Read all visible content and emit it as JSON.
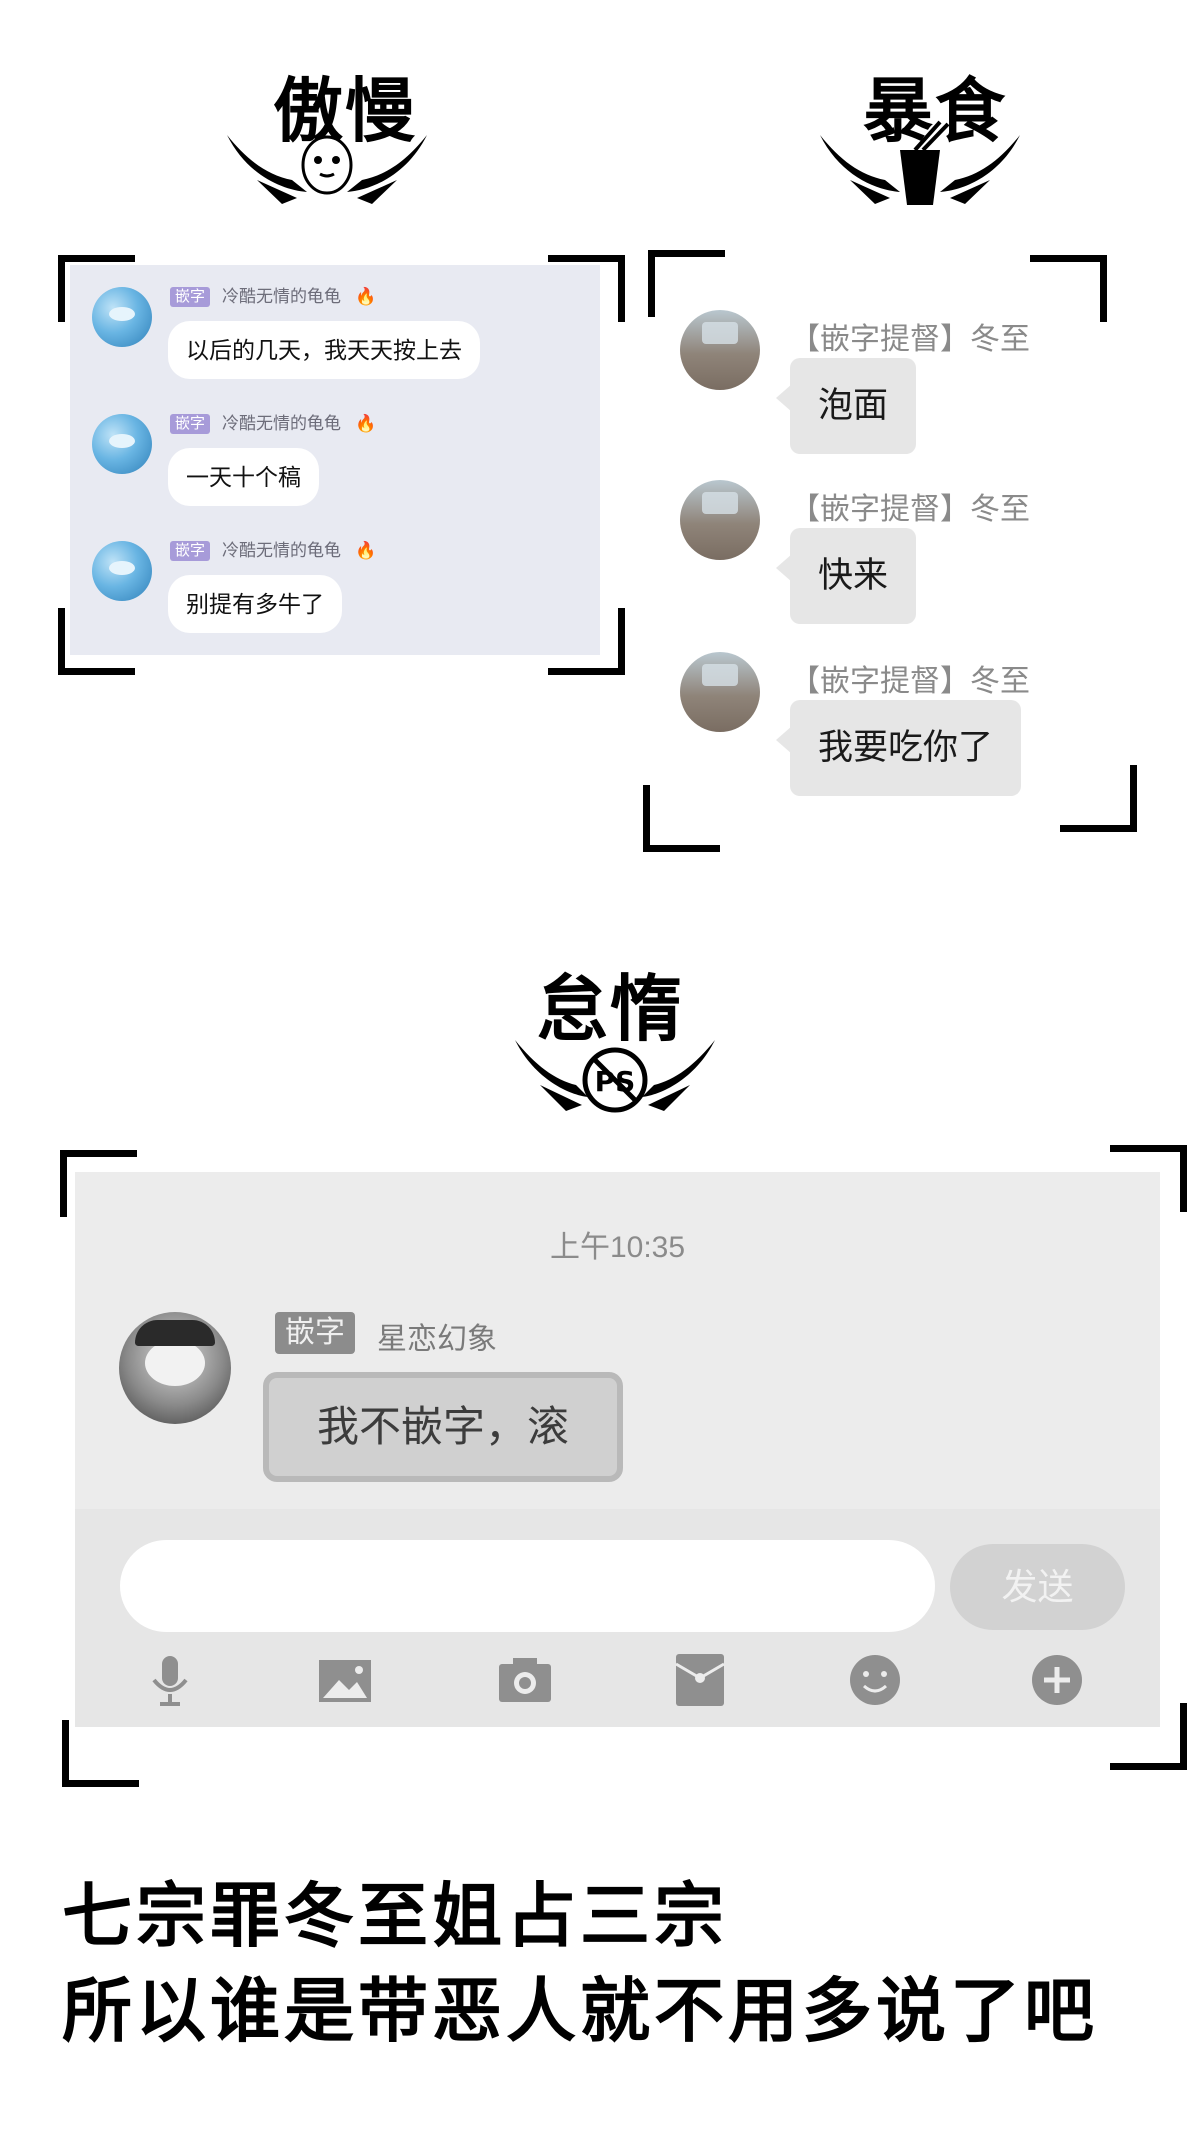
{
  "sections": {
    "pride": {
      "title": "傲慢",
      "messages": [
        {
          "tag": "嵌字",
          "name": "冷酷无情的龟龟",
          "text": "以后的几天，我天天按上去"
        },
        {
          "tag": "嵌字",
          "name": "冷酷无情的龟龟",
          "text": "一天十个稿"
        },
        {
          "tag": "嵌字",
          "name": "冷酷无情的龟龟",
          "text": "别提有多牛了"
        }
      ]
    },
    "gluttony": {
      "title": "暴食",
      "messages": [
        {
          "name": "【嵌字提督】冬至",
          "text": "泡面"
        },
        {
          "name": "【嵌字提督】冬至",
          "text": "快来"
        },
        {
          "name": "【嵌字提督】冬至",
          "text": "我要吃你了"
        }
      ]
    },
    "sloth": {
      "title": "怠惰",
      "emblem_text": "PS",
      "time": "上午10:35",
      "message": {
        "tag": "嵌字",
        "name": "星恋幻象",
        "text": "我不嵌字，滚"
      },
      "send_label": "发送",
      "toolbar_icons": [
        "microphone-icon",
        "image-icon",
        "camera-icon",
        "red-packet-icon",
        "emoji-icon",
        "plus-icon"
      ]
    }
  },
  "footer": {
    "line1": "七宗罪冬至姐占三宗",
    "line2": "所以谁是带恶人就不用多说了吧"
  },
  "colors": {
    "pride_panel_bg": "#e8eaf2",
    "pride_tag": "#a79bd9",
    "gluttony_bubble": "#e6e6e6",
    "sloth_panel_bg": "#ececec"
  }
}
